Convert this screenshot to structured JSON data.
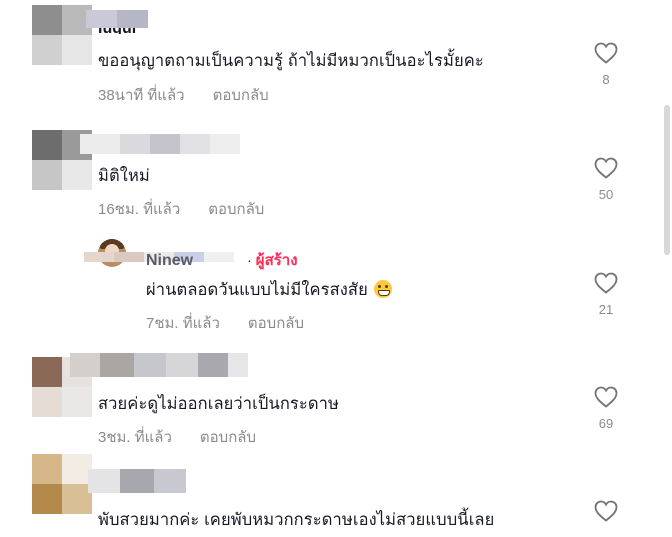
{
  "comments": [
    {
      "name_fragment": "Iugui",
      "text": "ขออนุญาตถามเป็นความรู้ ถ้าไม่มีหมวกเป็นอะไรมั้ยคะ",
      "time": "38นาที ที่แล้ว",
      "reply_label": "ตอบกลับ",
      "likes": "8"
    },
    {
      "text": "มิติใหม่",
      "time": "16ชม. ที่แล้ว",
      "reply_label": "ตอบกลับ",
      "likes": "50"
    },
    {
      "name_fragment": "Ninew",
      "separator": "·",
      "author_tag": "ผู้สร้าง",
      "text": "ผ่านตลอดวันแบบไม่มีใครสงสัย",
      "emoji": "grinning-face-emoji",
      "time": "7ชม. ที่แล้ว",
      "reply_label": "ตอบกลับ",
      "likes": "21"
    },
    {
      "text": "สวยค่ะดูไม่ออกเลยว่าเป็นกระดาษ",
      "time": "3ชม. ที่แล้ว",
      "reply_label": "ตอบกลับ",
      "likes": "69"
    },
    {
      "text": "พับสวยมากค่ะ เคยพับหมวกกระดาษเองไม่สวยแบบนี้เลย"
    }
  ],
  "icons": {
    "like": "heart-outline-icon"
  },
  "colors": {
    "creator_tag": "#fe2c55",
    "meta_text": "#8a8b91",
    "text": "#161823"
  }
}
